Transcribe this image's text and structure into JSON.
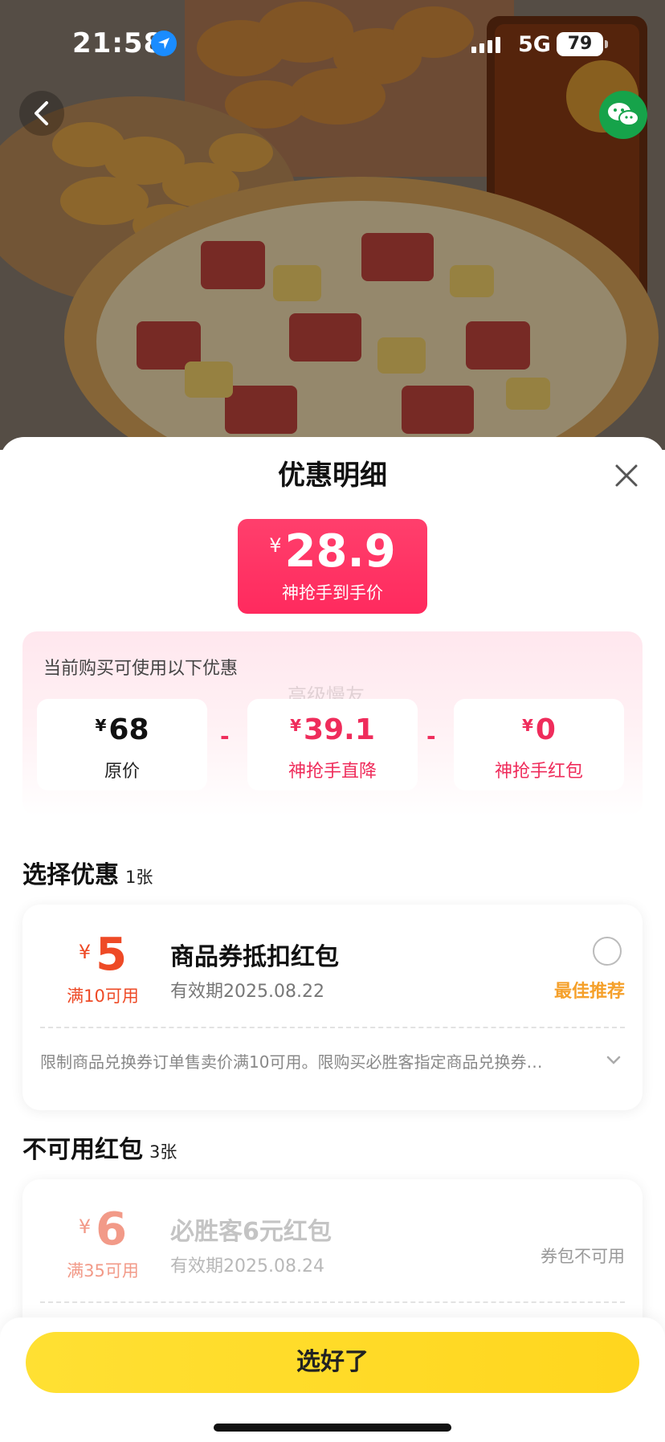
{
  "status_bar": {
    "time": "21:58",
    "network": "5G",
    "battery": "79"
  },
  "sheet": {
    "title": "优惠明细",
    "final_price": {
      "currency": "¥",
      "amount": "28.9",
      "label": "神抢手到手价"
    },
    "summary": {
      "title": "当前购买可使用以下优惠",
      "watermark": "高级慢友",
      "items": [
        {
          "currency": "¥",
          "value": "68",
          "label": "原价"
        },
        {
          "currency": "¥",
          "value": "39.1",
          "label": "神抢手直降"
        },
        {
          "currency": "¥",
          "value": "0",
          "label": "神抢手红包"
        }
      ],
      "operator": "-"
    },
    "select_section": {
      "title": "选择优惠",
      "count": "1张",
      "coupon": {
        "currency": "¥",
        "amount": "5",
        "condition": "满10可用",
        "name": "商品券抵扣红包",
        "expiry": "有效期2025.08.22",
        "recommend": "最佳推荐",
        "description": "限制商品兑换券订单售卖价满10可用。限购买必胜客指定商品兑换券…"
      }
    },
    "unavailable_section": {
      "title": "不可用红包",
      "count": "3张",
      "coupon": {
        "currency": "¥",
        "amount": "6",
        "condition": "满35可用",
        "name": "必胜客6元红包",
        "expiry": "有效期2025.08.24",
        "status": "券包不可用"
      }
    }
  },
  "footer": {
    "confirm_label": "选好了"
  },
  "colors": {
    "accent_pink": "#ef2c5b",
    "coupon_orange": "#ee4a26",
    "recommend": "#f5a02a",
    "confirm_yellow": "#ffd61e"
  },
  "icons": {
    "location": "location-arrow-icon",
    "back": "chevron-left-icon",
    "share": "wechat-icon",
    "close": "close-icon",
    "expand": "chevron-down-icon"
  }
}
